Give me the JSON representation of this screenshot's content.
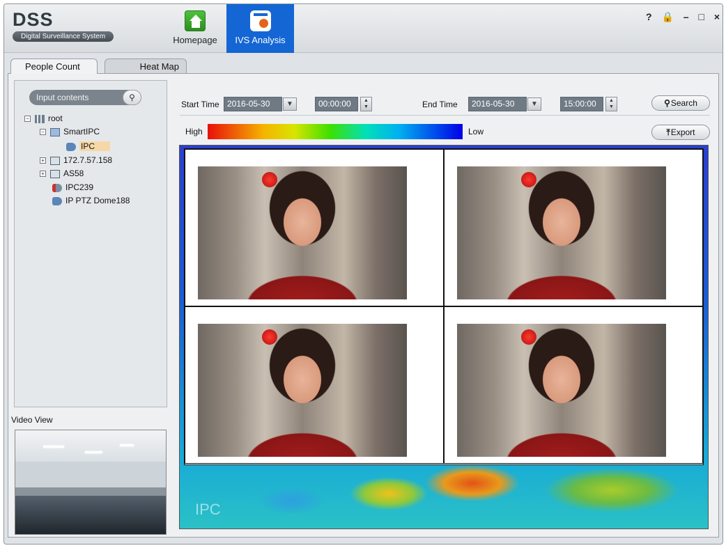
{
  "app": {
    "title": "DSS",
    "subtitle": "Digital Surveillance System"
  },
  "nav": {
    "home_label": "Homepage",
    "ivs_label": "IVS Analysis"
  },
  "window_controls": {
    "help": "?",
    "lock": "🔒",
    "minimize": "–",
    "maximize": "□",
    "close": "×"
  },
  "subtabs": {
    "people_count": "People Count",
    "heat_map": "Heat Map"
  },
  "search": {
    "placeholder": "Input contents",
    "icon": "search-icon"
  },
  "tree": {
    "root": "root",
    "smartipc": "SmartIPC",
    "ipc": "IPC",
    "device1": "172.7.57.158",
    "device2": "AS58",
    "ipc239": "IPC239",
    "ptz": "IP PTZ Dome188"
  },
  "video_view": {
    "label": "Video View"
  },
  "query": {
    "start_time_label": "Start Time",
    "start_date": "2016-05-30",
    "start_time": "00:00:00",
    "end_time_label": "End Time",
    "end_date": "2016-05-30",
    "end_time": "15:00:00",
    "search_label": "Search",
    "export_label": "Export"
  },
  "legend": {
    "high": "High",
    "low": "Low"
  },
  "heatmap": {
    "channel_label": "IPC"
  },
  "colors": {
    "accent": "#1466d4",
    "selected": "#f6d8a8"
  }
}
